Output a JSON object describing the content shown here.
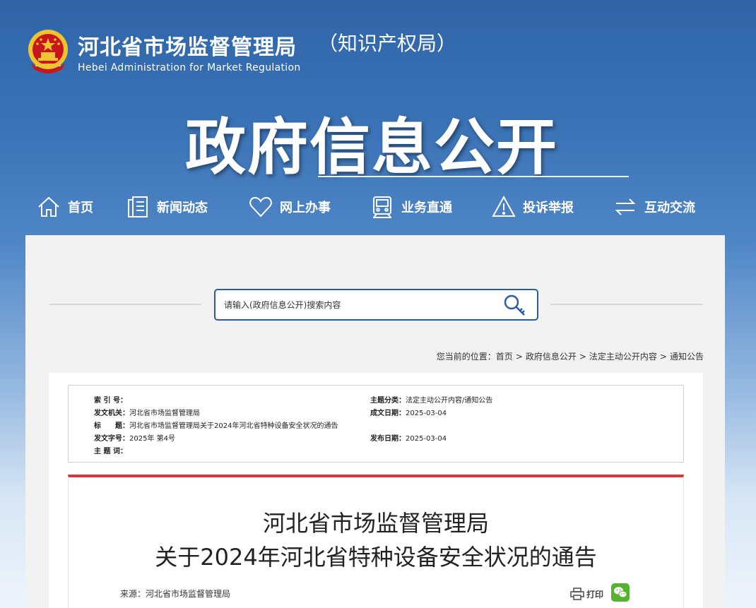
{
  "header": {
    "site_title": "河北省市场监督管理局",
    "site_subtitle": "（知识产权局）",
    "site_english": "Hebei Administration for Market Regulation",
    "banner_title": "政府信息公开"
  },
  "nav": {
    "items": [
      {
        "label": "首页",
        "icon": "home-icon"
      },
      {
        "label": "新闻动态",
        "icon": "document-icon"
      },
      {
        "label": "网上办事",
        "icon": "heart-icon"
      },
      {
        "label": "业务直通",
        "icon": "train-icon"
      },
      {
        "label": "投诉举报",
        "icon": "warning-icon"
      },
      {
        "label": "互动交流",
        "icon": "exchange-icon"
      }
    ]
  },
  "search": {
    "placeholder": "请输入(政府信息公开)搜索内容"
  },
  "breadcrumb": {
    "prefix": "您当前的位置：",
    "items": [
      "首页",
      "政府信息公开",
      "法定主动公开内容",
      "通知公告"
    ],
    "separator": ">"
  },
  "meta": {
    "index_key": "索 引 号：",
    "index_value": "",
    "issuer_key": "发文机关：",
    "issuer_value": "河北省市场监督管理局",
    "title_key": "标　　题：",
    "title_value": "河北省市场监督管理局关于2024年河北省特种设备安全状况的通告",
    "doc_no_key": "发文字号：",
    "doc_no_value": "2025年 第4号",
    "keywords_key": "主 题 词：",
    "keywords_value": "",
    "category_key": "主题分类：",
    "category_value": "法定主动公开内容/通知公告",
    "created_key": "成文日期：",
    "created_value": "2025-03-04",
    "published_key": "发布日期：",
    "published_value": "2025-03-04"
  },
  "article": {
    "title_line1": "河北省市场监督管理局",
    "title_line2": "关于2024年河北省特种设备安全状况的通告",
    "source": "来源：河北省市场监督管理局",
    "print_label": "打印"
  },
  "colors": {
    "header_blue": "#2f65a8",
    "search_border": "#2b5aa4",
    "article_accent": "#d03a3a",
    "wechat_green": "#57b22f"
  }
}
